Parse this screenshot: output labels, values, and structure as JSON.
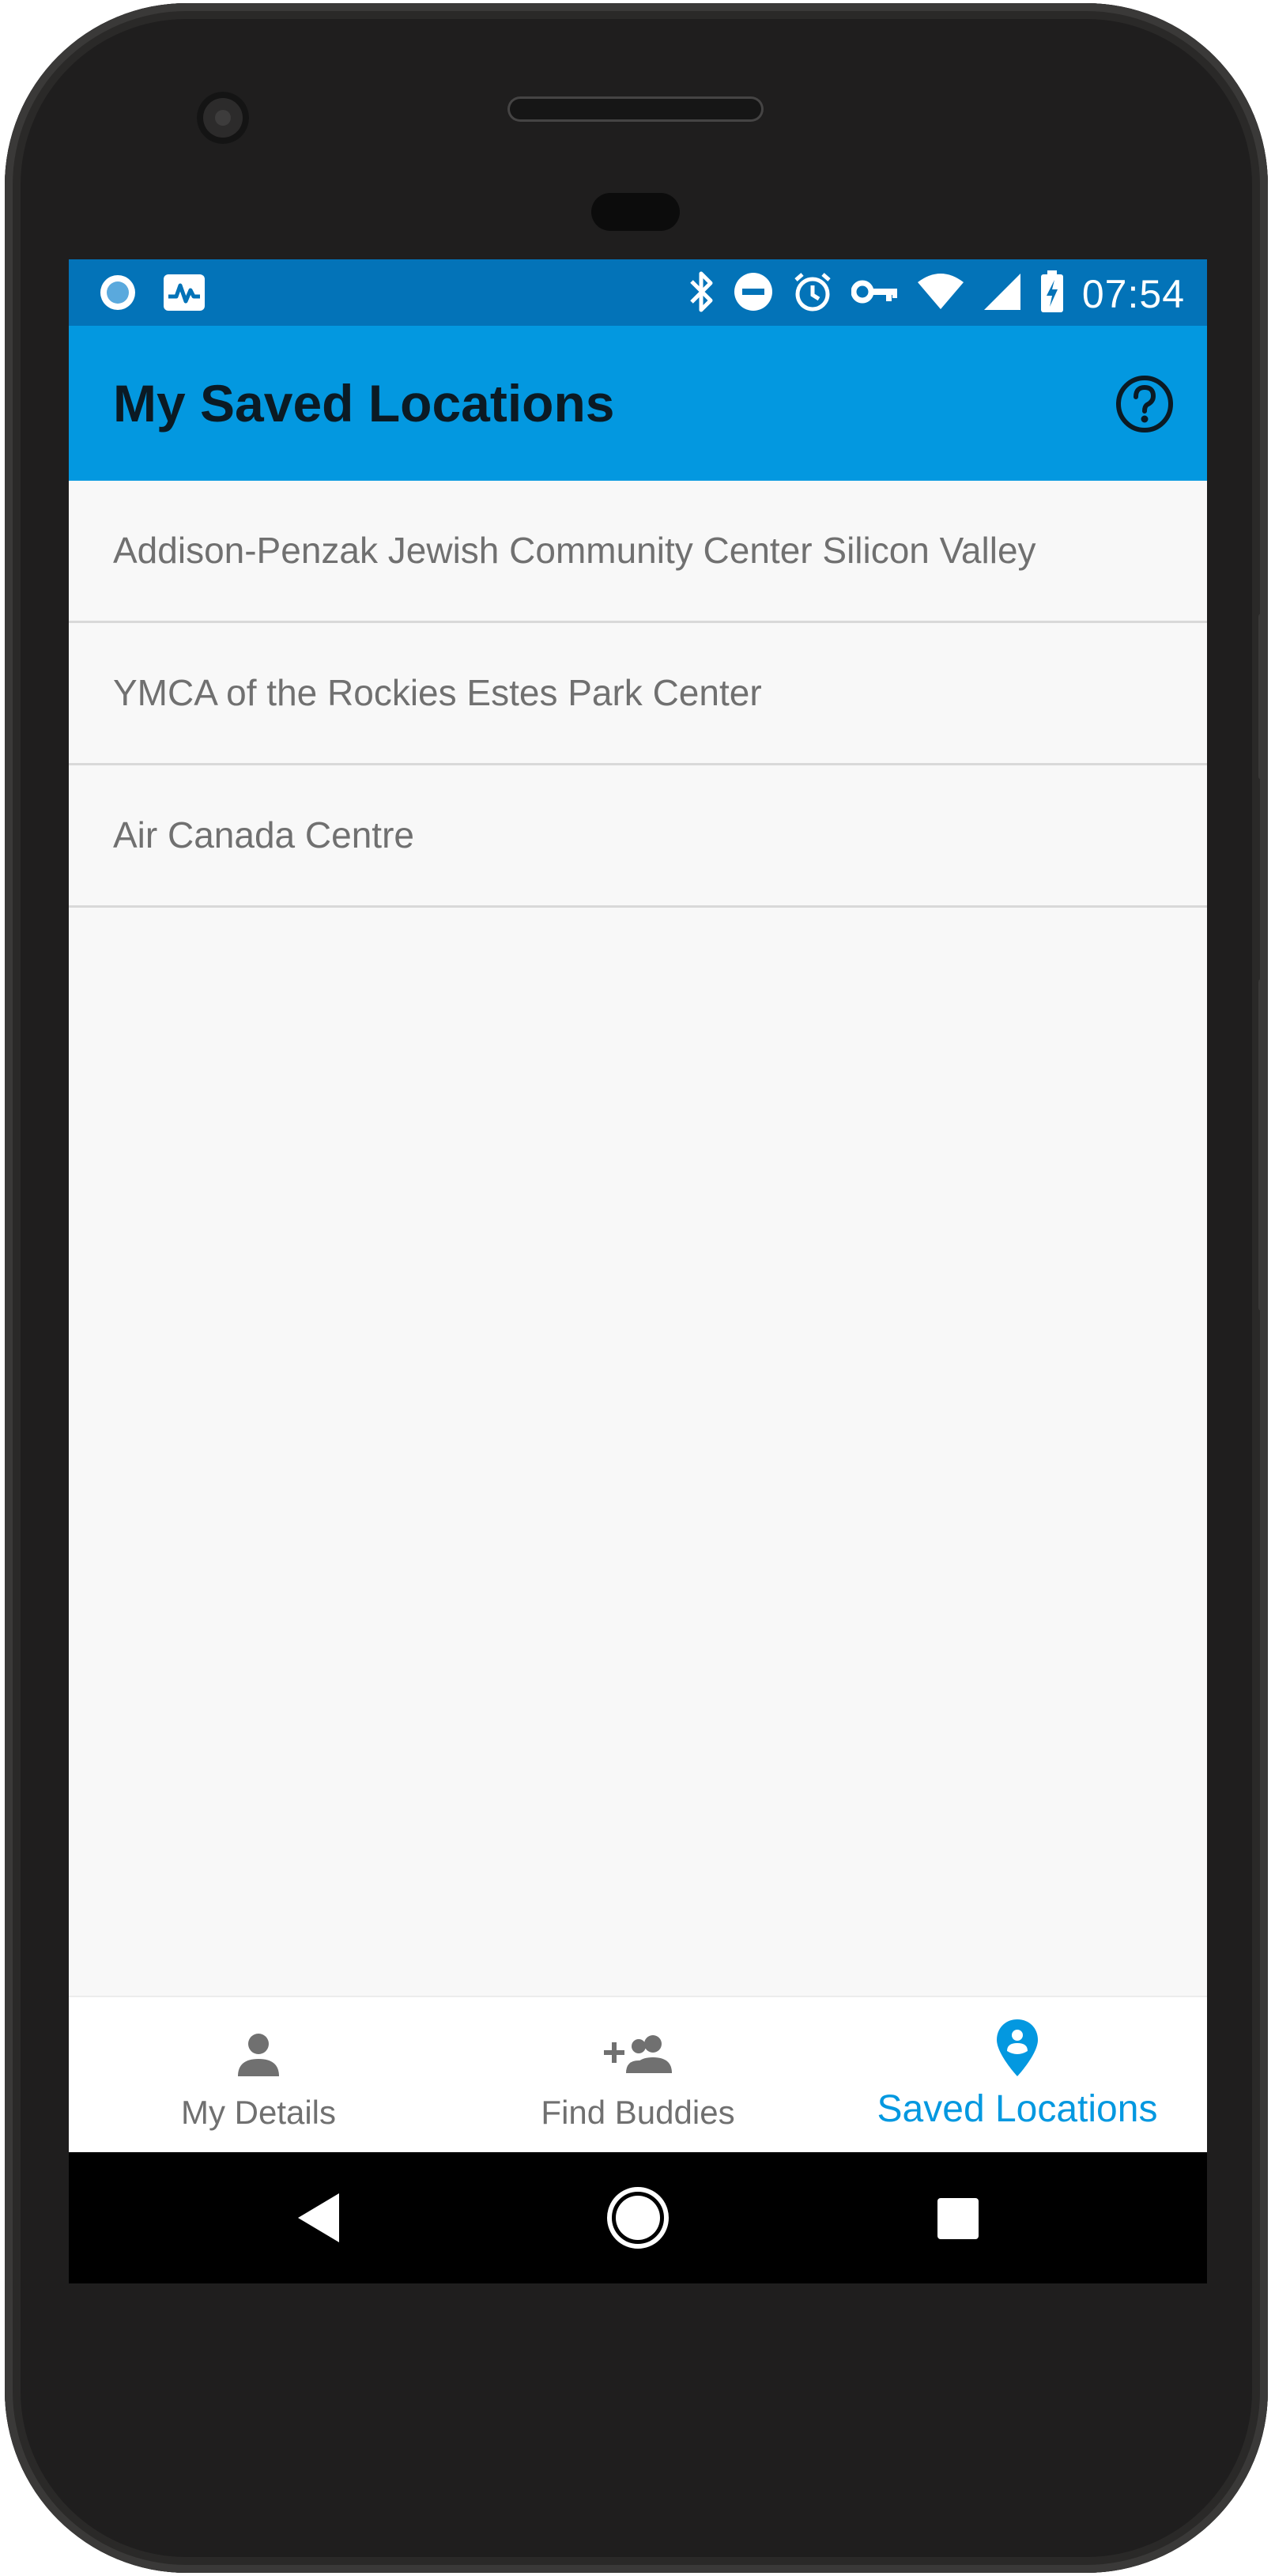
{
  "status_bar": {
    "time": "07:54",
    "left_icons": [
      "circle-app-icon",
      "activity-monitor-icon"
    ],
    "right_icons": [
      "bluetooth-icon",
      "do-not-disturb-icon",
      "alarm-icon",
      "vpn-key-icon",
      "wifi-icon",
      "cell-signal-icon",
      "battery-charging-icon"
    ]
  },
  "app_bar": {
    "title": "My Saved Locations",
    "help_icon": "help-circle-icon"
  },
  "locations": [
    {
      "name": "Addison-Penzak Jewish Community Center Silicon Valley"
    },
    {
      "name": "YMCA of the Rockies Estes Park Center"
    },
    {
      "name": "Air Canada Centre"
    }
  ],
  "bottom_nav": {
    "items": [
      {
        "label": "My Details",
        "icon": "person-icon",
        "active": false
      },
      {
        "label": "Find Buddies",
        "icon": "add-people-icon",
        "active": false
      },
      {
        "label": "Saved Locations",
        "icon": "location-pin-icon",
        "active": true
      }
    ]
  },
  "system_nav": {
    "icons": [
      "back-icon",
      "home-icon",
      "recents-icon"
    ]
  },
  "colors": {
    "status_bar": "#0373b8",
    "app_bar": "#0398e0",
    "active_nav": "#0398e0",
    "inactive_nav": "#707070",
    "list_text": "#707070",
    "background": "#f8f8f8"
  }
}
